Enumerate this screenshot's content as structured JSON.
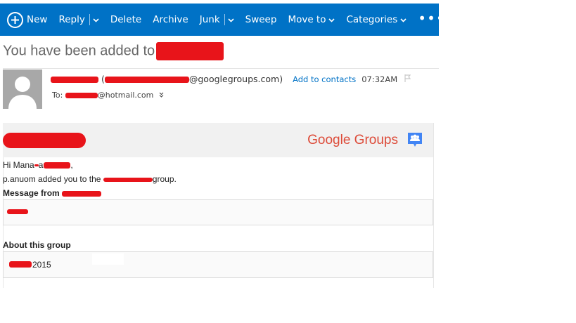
{
  "toolbar": {
    "new_label": "New",
    "reply_label": "Reply",
    "delete_label": "Delete",
    "archive_label": "Archive",
    "junk_label": "Junk",
    "sweep_label": "Sweep",
    "move_label": "Move to",
    "categories_label": "Categories",
    "more_label": "•••"
  },
  "message": {
    "subject": "You have been added to",
    "from_suffix": "@googlegroups.com)",
    "add_contacts": "Add to contacts",
    "time": "07:32AM",
    "to_label": "To:",
    "to_suffix": "@hotmail.com"
  },
  "body": {
    "brand": "Google Groups",
    "greeting": "Hi Mana",
    "added_text_start": "p.anuom added you to the",
    "added_text_end": "group.",
    "message_from_label": "Message from",
    "about_label": "About this group",
    "about_year": "2015"
  },
  "colors": {
    "toolbar_bg": "#0072c6",
    "brand_red": "#dd4b39",
    "link_blue": "#0072c6",
    "redaction": "#e8141a"
  }
}
